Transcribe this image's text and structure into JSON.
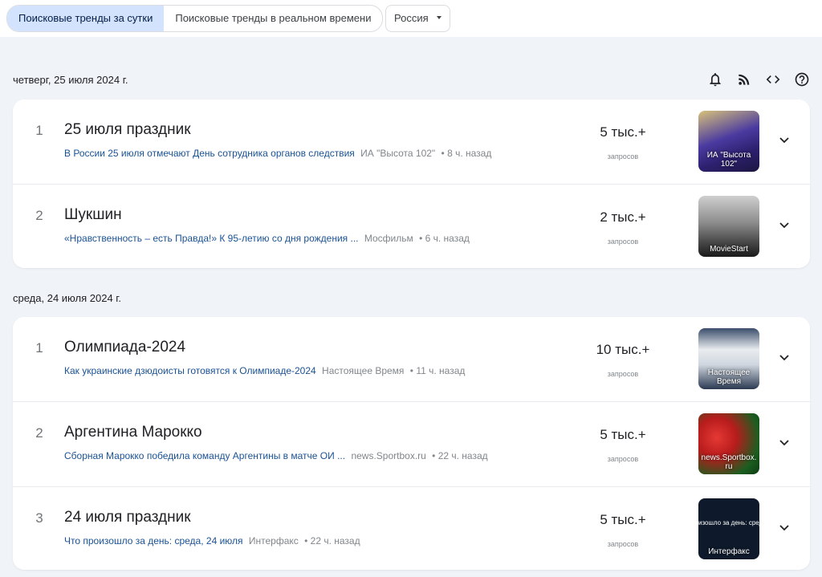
{
  "tabs": [
    {
      "label": "Поисковые тренды за сутки",
      "active": true
    },
    {
      "label": "Поисковые тренды в реальном времени",
      "active": false
    }
  ],
  "region": {
    "label": "Россия"
  },
  "toolbar_icons": [
    "bell-icon",
    "rss-icon",
    "embed-code-icon",
    "help-icon"
  ],
  "groups": [
    {
      "date": "четверг, 25 июля 2024 г.",
      "items": [
        {
          "rank": "1",
          "title": "25 июля праздник",
          "headline": "В России 25 июля отмечают День сотрудника органов следствия",
          "source": "ИА \"Высота 102\"",
          "time": "• 8 ч. назад",
          "count": "5 тыс.+",
          "count_label": "запросов",
          "thumb_caption": "ИА \"Высота 102\""
        },
        {
          "rank": "2",
          "title": "Шукшин",
          "headline": "«Нравственность – есть Правда!» К 95-летию со дня рождения ...",
          "source": "Мосфильм",
          "time": "• 6 ч. назад",
          "count": "2 тыс.+",
          "count_label": "запросов",
          "thumb_caption": "MovieStart"
        }
      ]
    },
    {
      "date": "среда, 24 июля 2024 г.",
      "items": [
        {
          "rank": "1",
          "title": "Олимпиада-2024",
          "headline": "Как украинские дзюдоисты готовятся к Олимпиаде-2024",
          "source": "Настоящее Время",
          "time": "• 11 ч. назад",
          "count": "10 тыс.+",
          "count_label": "запросов",
          "thumb_caption": "Настоящее Время"
        },
        {
          "rank": "2",
          "title": "Аргентина Марокко",
          "headline": "Сборная Марокко победила команду Аргентины в матче ОИ ...",
          "source": "news.Sportbox.ru",
          "time": "• 22 ч. назад",
          "count": "5 тыс.+",
          "count_label": "запросов",
          "thumb_caption": "news.Sportbox. ru"
        },
        {
          "rank": "3",
          "title": "24 июля праздник",
          "headline": "Что произошло за день: среда, 24 июля",
          "source": "Интерфакс",
          "time": "• 22 ч. назад",
          "count": "5 тыс.+",
          "count_label": "запросов",
          "thumb_caption": "Интерфакс",
          "thumb_text": "изошло за день: сред"
        }
      ]
    }
  ]
}
